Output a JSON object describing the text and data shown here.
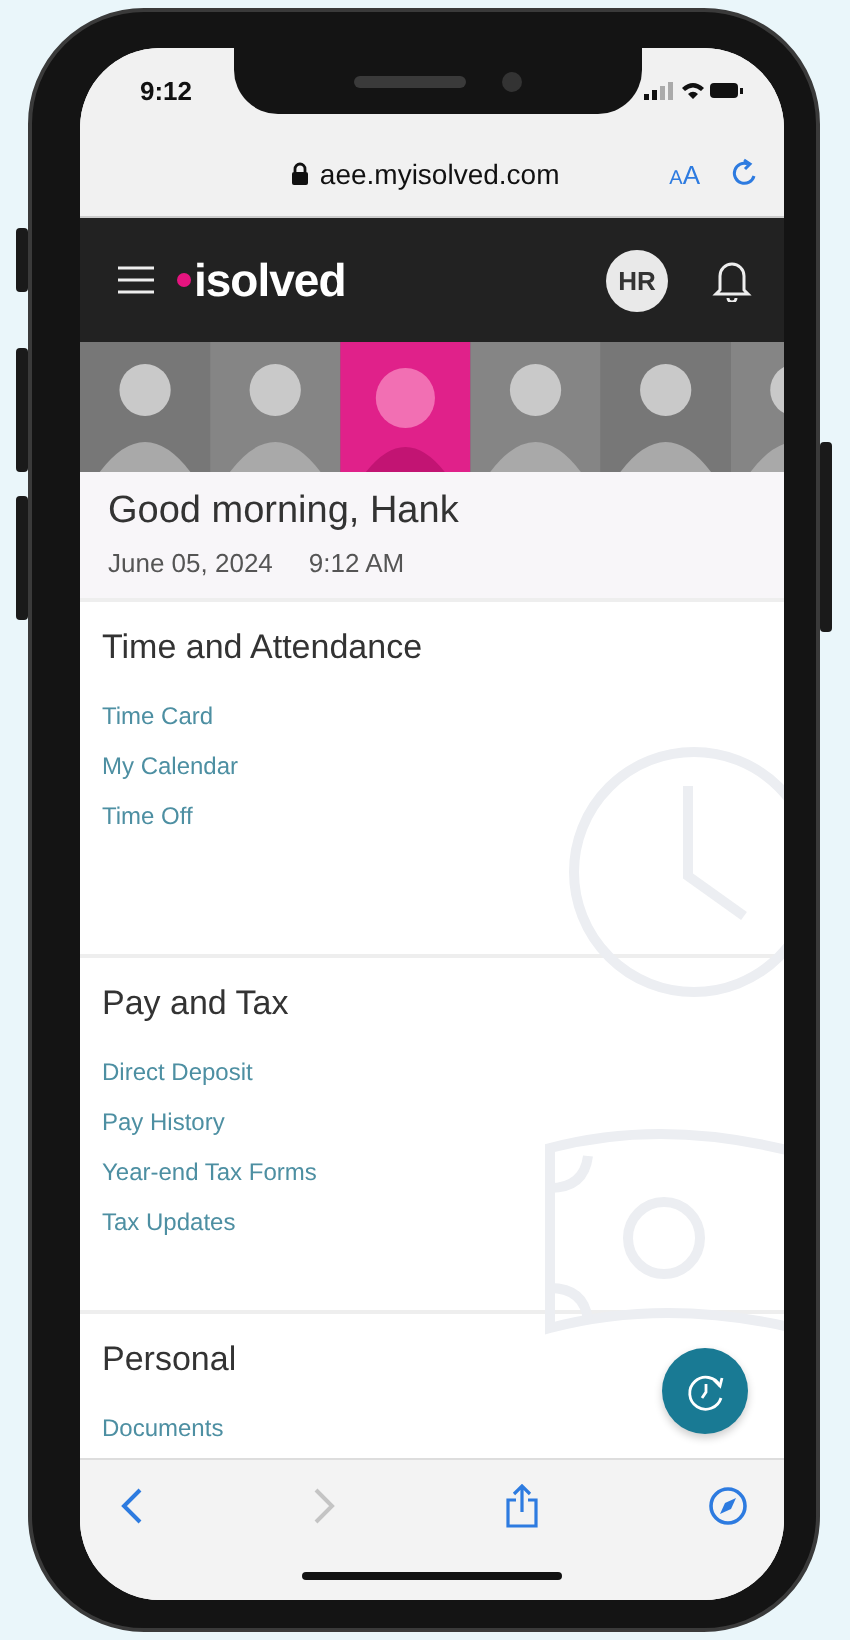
{
  "status_bar": {
    "time": "9:12"
  },
  "browser": {
    "url": "aee.myisolved.com",
    "text_size": "AA"
  },
  "header": {
    "logo": "isolved",
    "avatar": "HR"
  },
  "greeting": {
    "title": "Good morning, Hank",
    "date": "June 05, 2024",
    "time": "9:12 AM"
  },
  "sections": [
    {
      "title": "Time and Attendance",
      "kind": "clock",
      "links": [
        "Time Card",
        "My Calendar",
        "Time Off"
      ]
    },
    {
      "title": "Pay and Tax",
      "kind": "money",
      "links": [
        "Direct Deposit",
        "Pay History",
        "Year-end Tax Forms",
        "Tax Updates"
      ]
    },
    {
      "title": "Personal",
      "kind": "none",
      "links": [
        "Documents"
      ]
    }
  ],
  "toolbar": {
    "forward_disabled": true
  }
}
